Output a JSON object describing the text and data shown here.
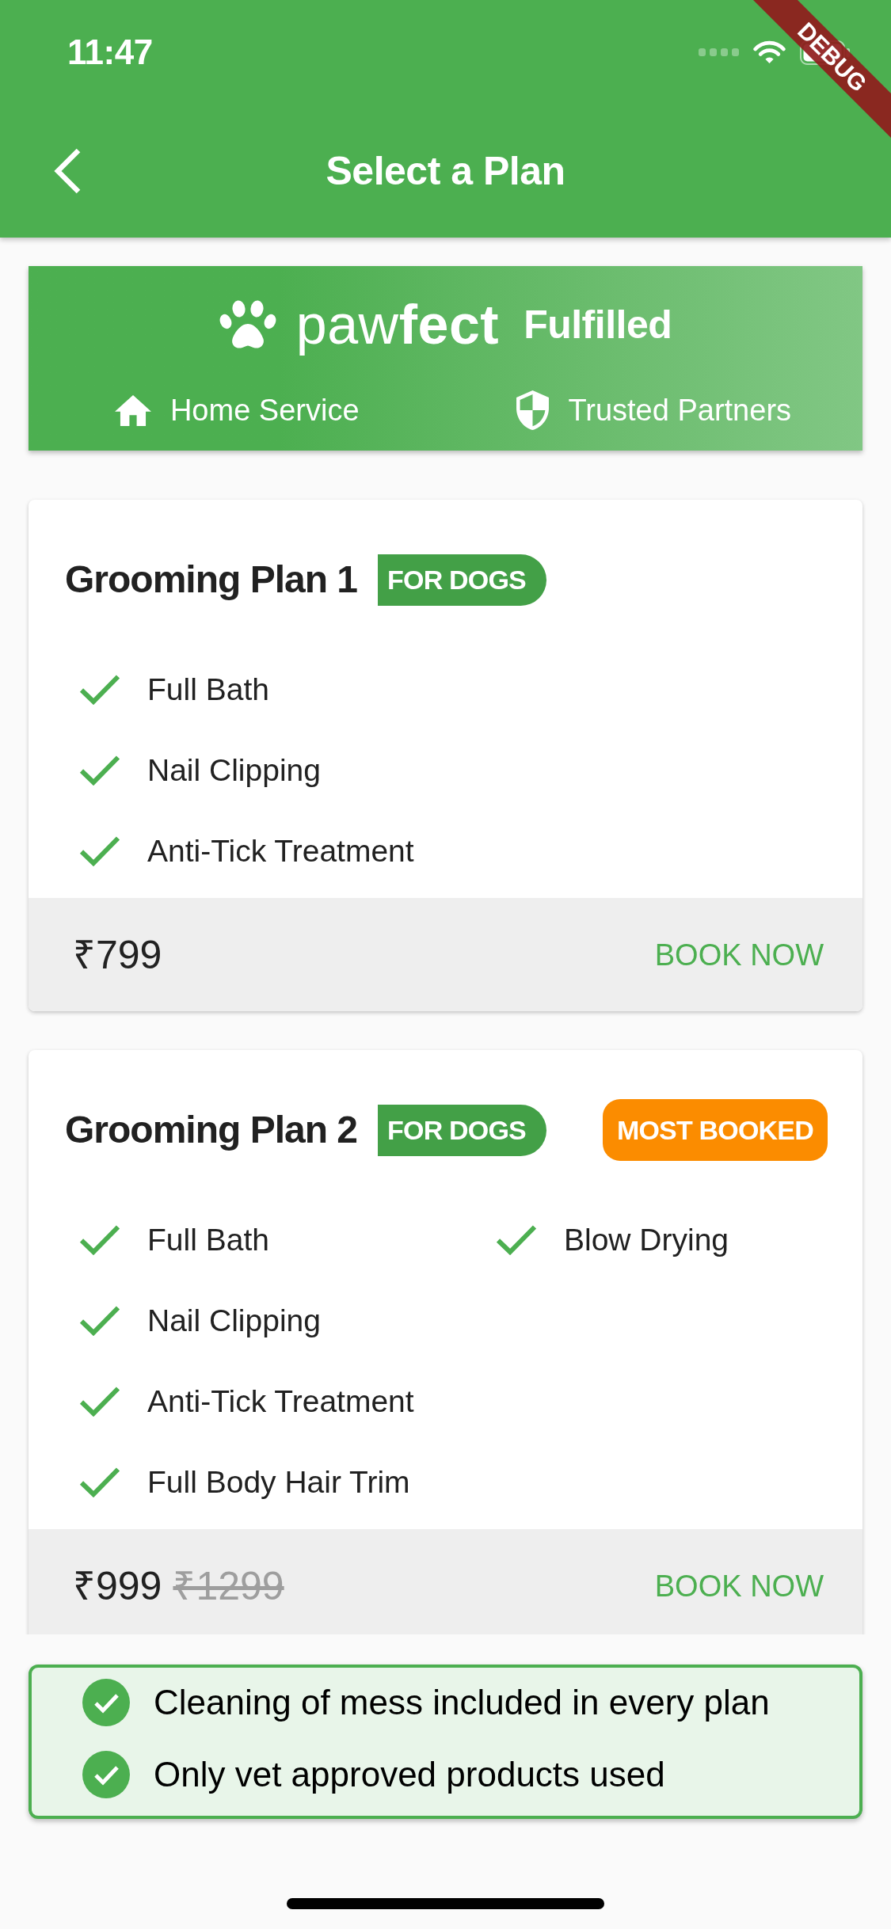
{
  "status_bar": {
    "time": "11:47"
  },
  "debug_banner": {
    "label": "DEBUG"
  },
  "app_bar": {
    "title": "Select a Plan"
  },
  "promo_banner": {
    "brand": "paw**fect**",
    "tagline": "Fulfilled",
    "highlights": [
      {
        "kind": "home",
        "label": "Home Service"
      },
      {
        "kind": "shield",
        "label": "Trusted Partners"
      }
    ]
  },
  "plans": [
    {
      "title": "Grooming Plan 1",
      "tag": "FOR DOGS",
      "feature_columns": [
        [
          "Full Bath",
          "Nail Clipping",
          "Anti-Tick Treatment"
        ]
      ],
      "price": "₹799",
      "action": "BOOK NOW"
    },
    {
      "title": "Grooming Plan 2",
      "tag": "FOR DOGS",
      "badge": "MOST BOOKED",
      "feature_columns": [
        [
          "Full Bath",
          "Nail Clipping",
          "Anti-Tick Treatment",
          "Full Body Hair Trim"
        ],
        [
          "Blow Drying"
        ]
      ],
      "price": "₹999",
      "original_price": "₹1299",
      "action": "BOOK NOW"
    }
  ],
  "assurances": [
    "Cleaning of mess included in every plan",
    "Only vet approved products used"
  ]
}
